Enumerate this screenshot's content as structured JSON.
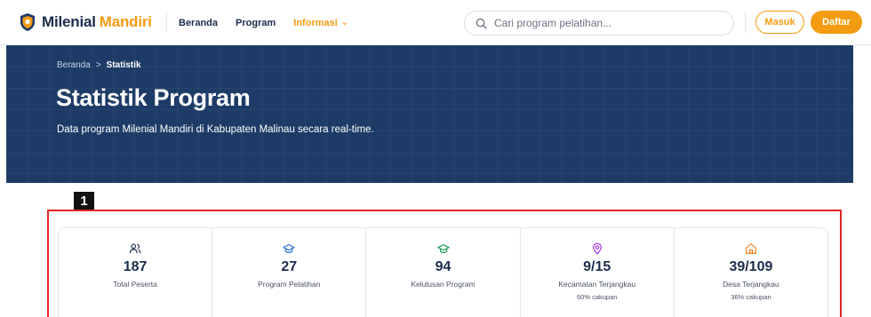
{
  "header": {
    "brand": {
      "name_part1": "Milenial",
      "name_part2": "Mandiri"
    },
    "nav": [
      {
        "label": "Beranda"
      },
      {
        "label": "Program"
      },
      {
        "label": "Informasi"
      }
    ],
    "search": {
      "placeholder": "Cari program pelatihan...",
      "value": ""
    },
    "login_label": "Masuk",
    "register_label": "Daftar",
    "accent_color": "#f39c12",
    "navy_color": "#1d3b66"
  },
  "hero": {
    "breadcrumb": {
      "home": "Beranda",
      "separator": ">",
      "current": "Statistik"
    },
    "title": "Statistik Program",
    "subtitle": "Data program Milenial Mandiri di Kabupaten Malinau secara real-time."
  },
  "annotation": {
    "number": "1"
  },
  "stats": [
    {
      "icon": "users-icon",
      "value": "187",
      "label": "Total Peserta",
      "note": "",
      "color": "#1c2c4c"
    },
    {
      "icon": "graduation-cap-icon",
      "value": "27",
      "label": "Program Pelatihan",
      "note": "",
      "color": "#2a6fd6"
    },
    {
      "icon": "graduation-cap-icon",
      "value": "94",
      "label": "Kelulusan Program",
      "note": "",
      "color": "#1e9e55"
    },
    {
      "icon": "map-pin-icon",
      "value": "9/15",
      "label": "Kecamatan Terjangkau",
      "note": "60% cakupan",
      "color": "#9b2fd6"
    },
    {
      "icon": "home-icon",
      "value": "39/109",
      "label": "Desa Terjangkau",
      "note": "36% cakupan",
      "color": "#f07a16"
    }
  ]
}
